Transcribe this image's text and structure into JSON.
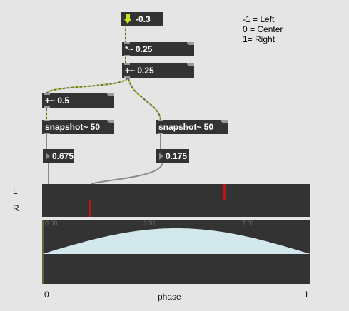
{
  "patch": {
    "number_in": "-0.3",
    "mul_object": "*~ 0.25",
    "add_object_a": "+~ 0.25",
    "add_object_b": "+~ 0.5",
    "snapshot_left": "snapshot~ 50",
    "snapshot_right": "snapshot~ 50",
    "value_left": "0.675",
    "value_right": "0.175"
  },
  "notes": {
    "line1": "-1 = Left",
    "line2": "0 = Center",
    "line3": "1= Right"
  },
  "meter": {
    "label_l": "L",
    "label_r": "R",
    "l_value": 0.675,
    "r_value": 0.175,
    "marker_color": "#c11414"
  },
  "scope": {
    "tick_left": "0.00",
    "tick_mid": "3.91",
    "tick_right": "7.81",
    "fill_color": "#d3e8ec",
    "background": "#333333"
  },
  "axis": {
    "start": "0",
    "end": "1",
    "title": "phase"
  },
  "icons": {
    "number_arrow": "down-arrow-icon",
    "numbox_triangle": "triangle-right-icon"
  }
}
